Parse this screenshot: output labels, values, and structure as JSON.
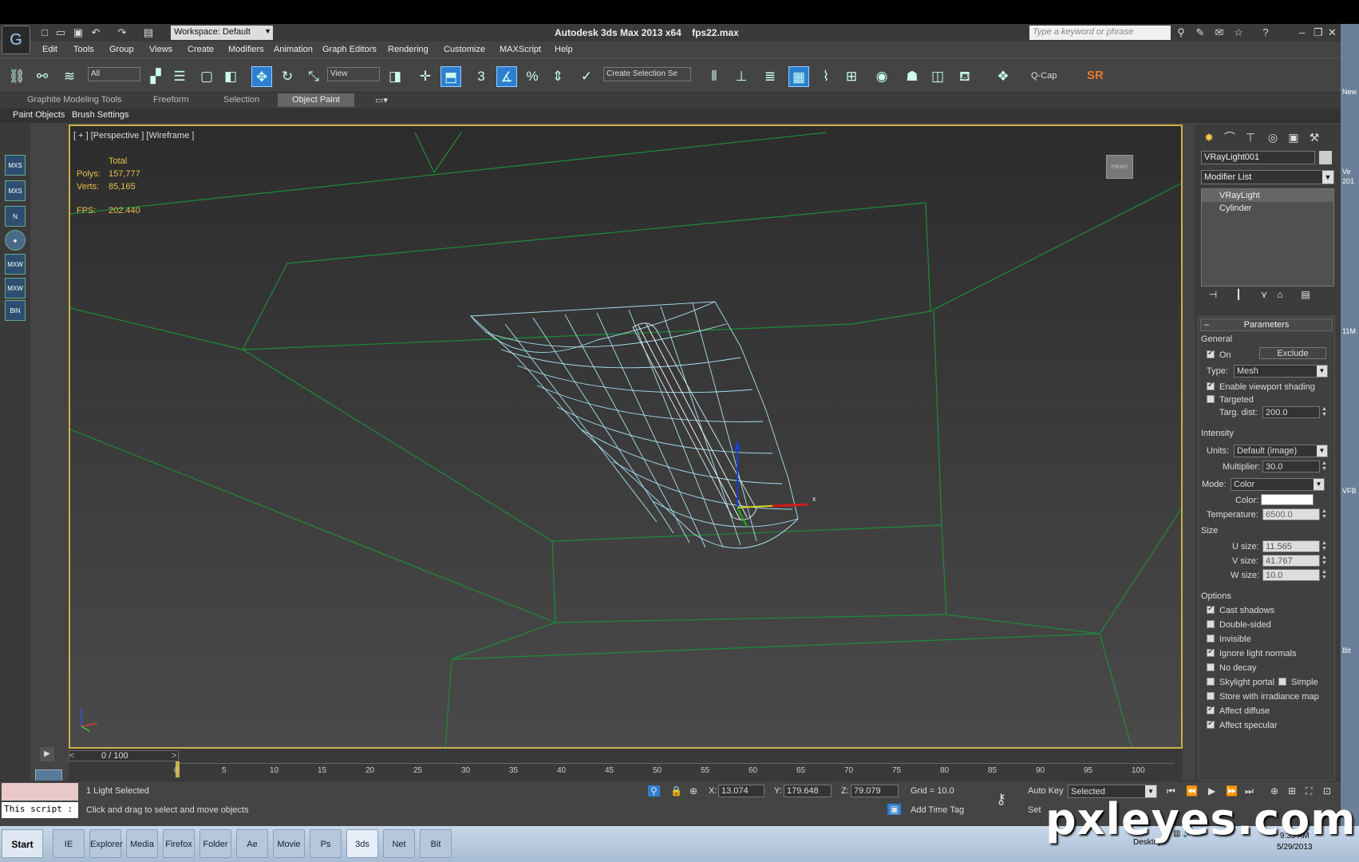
{
  "title": {
    "app": "Autodesk 3ds Max  2013 x64",
    "file": "fps22.max",
    "workspace": "Workspace: Default",
    "search_placeholder": "Type a keyword or phrase"
  },
  "menu": [
    "Edit",
    "Tools",
    "Group",
    "Views",
    "Create",
    "Modifiers",
    "Animation",
    "Graph Editors",
    "Rendering",
    "Customize",
    "MAXScript",
    "Help"
  ],
  "toolbar": {
    "filter": "All",
    "refcoord": "View",
    "selset": "Create Selection Se",
    "qcap": "Q-Cap",
    "sr": "SR"
  },
  "ribbon": {
    "tabs": [
      "Graphite Modeling Tools",
      "Freeform",
      "Selection",
      "Object Paint"
    ],
    "active": "Object Paint",
    "sub": [
      "Paint Objects",
      "Brush Settings"
    ]
  },
  "viewport": {
    "label": "[ + ] [Perspective ] [Wireframe ]",
    "stats_total": "Total",
    "polys_label": "Polys:",
    "polys": "157,777",
    "verts_label": "Verts:",
    "verts": "85,165",
    "fps_label": "FPS:",
    "fps": "202.440",
    "cube": "FRONT"
  },
  "command_panel": {
    "object_name": "VRayLight001",
    "modifier_list": "Modifier List",
    "stack": [
      "VRayLight",
      "Cylinder"
    ],
    "rollout": "Parameters",
    "general": "General",
    "on_label": "On",
    "exclude": "Exclude",
    "type_label": "Type:",
    "type_value": "Mesh",
    "enable_shading": "Enable viewport shading",
    "targeted": "Targeted",
    "targ_dist_label": "Targ. dist:",
    "targ_dist": "200.0",
    "intensity": "Intensity",
    "units_label": "Units:",
    "units": "Default (image)",
    "multiplier_label": "Multiplier:",
    "multiplier": "30.0",
    "mode_label": "Mode:",
    "mode": "Color",
    "color_label": "Color:",
    "temp_label": "Temperature:",
    "temp": "6500.0",
    "size": "Size",
    "u_label": "U size:",
    "u": "11.565",
    "v_label": "V size:",
    "v": "41.767",
    "w_label": "W size:",
    "w": "10.0",
    "options": "Options",
    "opts": [
      {
        "label": "Cast shadows",
        "on": true
      },
      {
        "label": "Double-sided",
        "on": false
      },
      {
        "label": "Invisible",
        "on": false
      },
      {
        "label": "Ignore light normals",
        "on": true
      },
      {
        "label": "No decay",
        "on": false
      },
      {
        "label": "Skylight portal",
        "on": false
      },
      {
        "label": "Store with irradiance map",
        "on": false
      },
      {
        "label": "Affect diffuse",
        "on": true
      },
      {
        "label": "Affect specular",
        "on": true
      }
    ],
    "simple": "Simple"
  },
  "timeline": {
    "position": "0 / 100",
    "ticks": [
      "0",
      "5",
      "10",
      "15",
      "20",
      "25",
      "30",
      "35",
      "40",
      "45",
      "50",
      "55",
      "60",
      "65",
      "70",
      "75",
      "80",
      "85",
      "90",
      "95",
      "100"
    ]
  },
  "status": {
    "script": "This script :",
    "selection": "1 Light Selected",
    "hint": "Click and drag to select and move objects",
    "x_label": "X:",
    "x": "13.074",
    "y_label": "Y:",
    "y": "179.648",
    "z_label": "Z:",
    "z": "79.079",
    "grid": "Grid = 10.0",
    "add_time_tag": "Add Time Tag",
    "auto_key": "Auto Key",
    "set_key": "Set",
    "selected": "Selected"
  },
  "right_edge": [
    "New",
    "Ve",
    "201",
    "11M",
    "VFB",
    "Bit"
  ],
  "taskbar": {
    "start": "Start",
    "apps": [
      "IE",
      "Explorer",
      "Media",
      "Firefox",
      "Folder",
      "Ae",
      "Movie",
      "Ps",
      "3ds",
      "Net",
      "Bit"
    ],
    "desktop": "Desktop",
    "time": "9:35 AM",
    "date": "5/29/2013"
  },
  "watermark": "pxleyes.com"
}
